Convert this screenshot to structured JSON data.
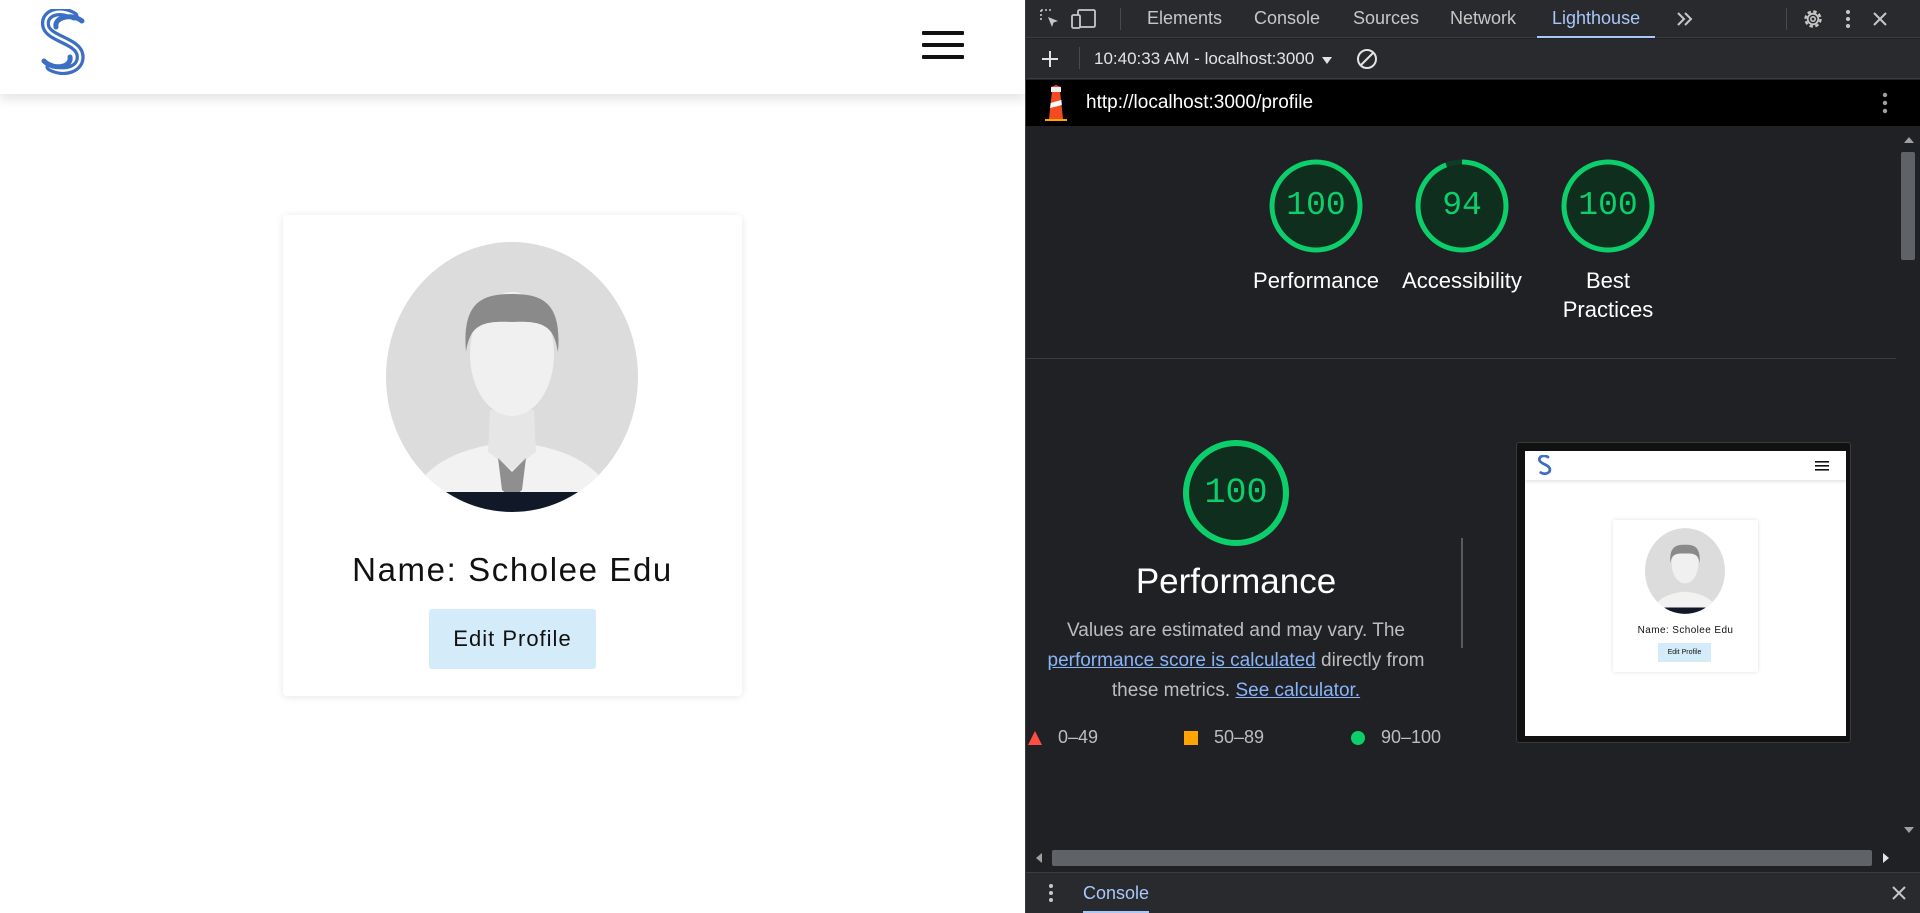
{
  "web_page": {
    "nav": {
      "logo_icon": "scholee-s-logo-icon",
      "menu_icon": "hamburger-menu-icon"
    },
    "profile": {
      "avatar_icon": "default-user-avatar-icon",
      "name_text": "Name: Scholee Edu",
      "edit_button_label": "Edit Profile"
    }
  },
  "devtools": {
    "tabs": [
      {
        "label": "Elements",
        "active": false
      },
      {
        "label": "Console",
        "active": false
      },
      {
        "label": "Sources",
        "active": false
      },
      {
        "label": "Network",
        "active": false
      },
      {
        "label": "Lighthouse",
        "active": true
      }
    ],
    "more_tabs_icon": "double-chevron-right-icon",
    "lighthouse": {
      "report_select": "10:40:33 AM - localhost:3000",
      "url": "http://localhost:3000/profile",
      "scores": [
        {
          "value": "100",
          "fraction": 1.0,
          "label_line1": "Performance",
          "label_line2": ""
        },
        {
          "value": "94",
          "fraction": 0.94,
          "label_line1": "Accessibility",
          "label_line2": ""
        },
        {
          "value": "100",
          "fraction": 1.0,
          "label_line1": "Best",
          "label_line2": "Practices"
        }
      ],
      "performance": {
        "score": "100",
        "fraction": 1.0,
        "title": "Performance",
        "desc_part1": "Values are estimated and may vary. The",
        "desc_link1": "performance score is calculated",
        "desc_part2": "directly from these metrics.",
        "desc_link2": "See calculator."
      },
      "legend": [
        {
          "range": "0–49",
          "shape": "triangle",
          "color": "#ff4e42"
        },
        {
          "range": "50–89",
          "shape": "square",
          "color": "#ffa400"
        },
        {
          "range": "90–100",
          "shape": "circle",
          "color": "#0cce6b"
        }
      ],
      "screenshot": {
        "name_text": "Name: Scholee Edu",
        "button_label": "Edit Profile"
      }
    },
    "drawer": {
      "console_tab": "Console"
    }
  },
  "colors": {
    "pass_green": "#0cce6b",
    "gauge_fill": "#0f2e1d",
    "accent_blue": "#a8c7fa",
    "logo_blue": "#3c6fc3",
    "button_bg": "#d4ebf9"
  }
}
